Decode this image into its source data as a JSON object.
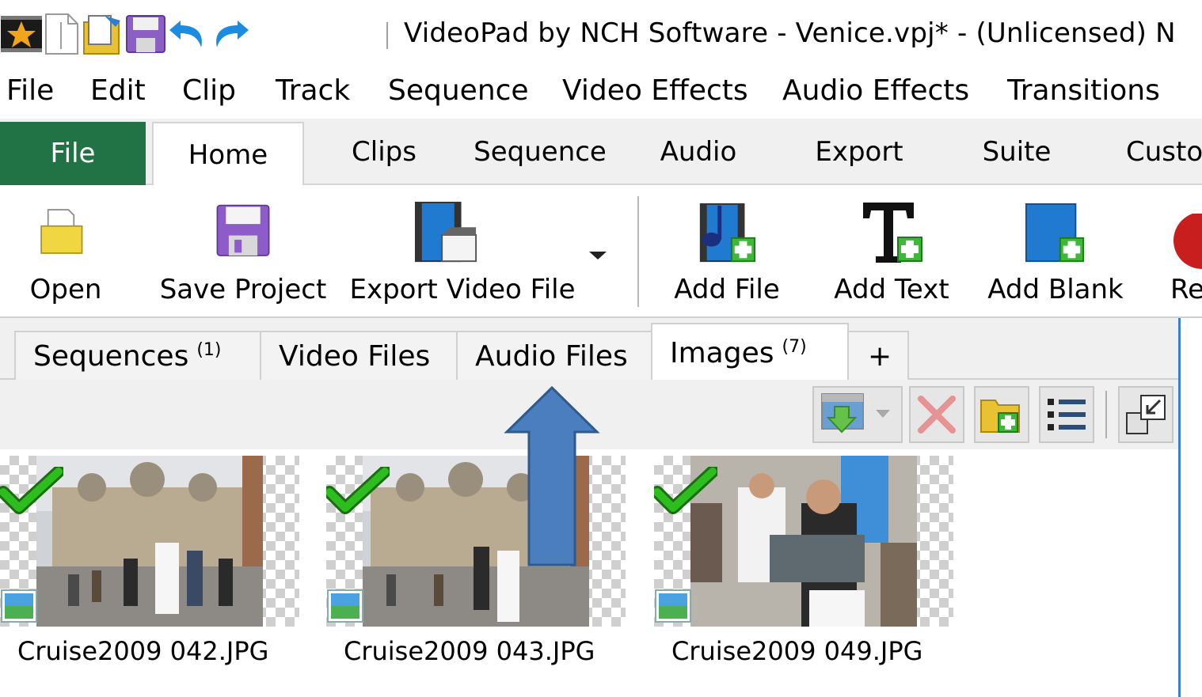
{
  "window": {
    "title": "VideoPad by NCH Software - Venice.vpj* - (Unlicensed) N"
  },
  "menubar": {
    "items": [
      "File",
      "Edit",
      "Clip",
      "Track",
      "Sequence",
      "Video Effects",
      "Audio Effects",
      "Transitions"
    ]
  },
  "ribbon": {
    "tabs": [
      "File",
      "Home",
      "Clips",
      "Sequence",
      "Audio",
      "Export",
      "Suite",
      "Custo"
    ],
    "active_tab": "Home",
    "buttons": {
      "open": "Open",
      "save_project": "Save Project",
      "export_video": "Export Video File",
      "add_file": "Add File",
      "add_text": "Add Text",
      "add_blank": "Add Blank",
      "record": "Re"
    }
  },
  "bin": {
    "tabs": [
      {
        "label": "Sequences",
        "count": "(1)"
      },
      {
        "label": "Video Files",
        "count": ""
      },
      {
        "label": "Audio Files",
        "count": ""
      },
      {
        "label": "Images",
        "count": "(7)"
      }
    ],
    "add_tab_label": "+",
    "active_tab": "Images",
    "items": [
      {
        "name": "Cruise2009 042.JPG",
        "checked": true
      },
      {
        "name": "Cruise2009 043.JPG",
        "checked": true
      },
      {
        "name": "Cruise2009 049.JPG",
        "checked": true
      }
    ]
  },
  "colors": {
    "file_tab_bg": "#217346",
    "arrow_fill": "#4a7ebf",
    "arrow_stroke": "#2e5a8c",
    "check_green": "#2dbd1f",
    "panel_border": "#3b7dd8"
  }
}
